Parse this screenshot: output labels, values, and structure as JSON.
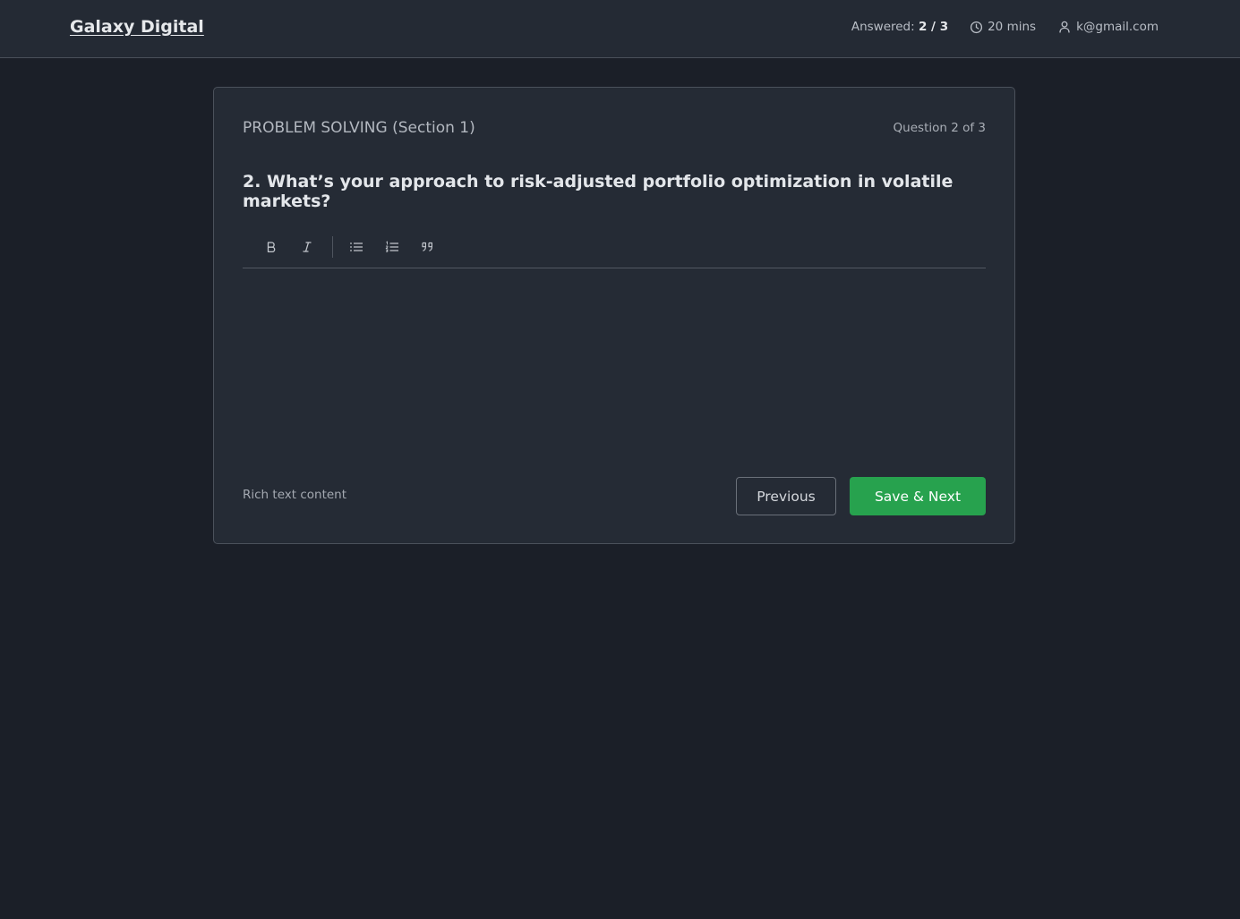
{
  "header": {
    "brand": "Galaxy Digital",
    "answered_label": "Answered: ",
    "answered_value": "2 / 3",
    "timer": "20 mins",
    "user_email": "k@gmail.com"
  },
  "card": {
    "section_title": "PROBLEM SOLVING (Section 1)",
    "question_counter": "Question 2 of 3",
    "question": "2. What’s your approach to risk-adjusted portfolio optimization in volatile markets?",
    "hint": "Rich text content",
    "previous_label": "Previous",
    "next_label": "Save & Next",
    "editor_value": ""
  },
  "toolbar": {
    "icons": [
      "bold-icon",
      "italic-icon",
      "bullet-list-icon",
      "numbered-list-icon",
      "quote-icon"
    ]
  },
  "colors": {
    "background": "#1b1f28",
    "panel": "#252b35",
    "accent": "#27a24e"
  }
}
